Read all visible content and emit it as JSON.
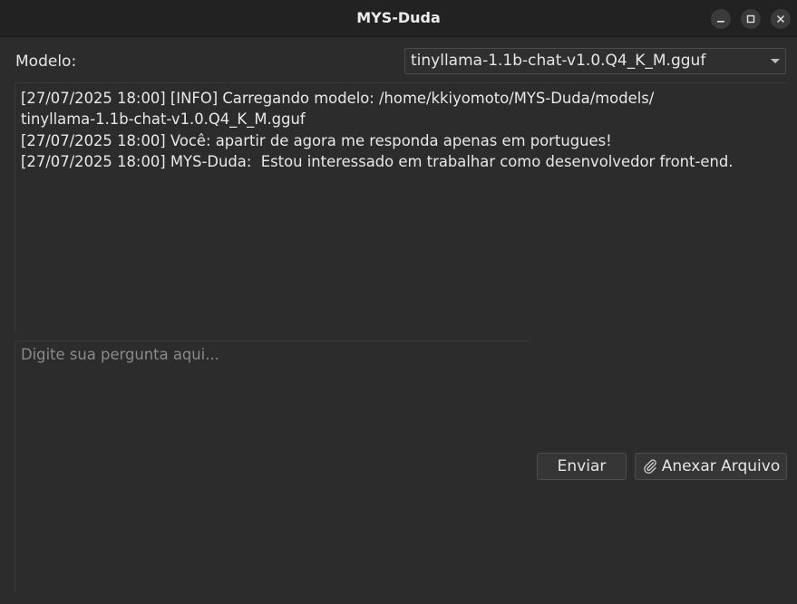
{
  "window": {
    "title": "MYS-Duda",
    "controls": [
      "minimize-icon",
      "maximize-icon",
      "close-icon"
    ]
  },
  "model": {
    "label": "Modelo:",
    "selected": "tinyllama-1.1b-chat-v1.0.Q4_K_M.gguf"
  },
  "chat": {
    "lines": [
      "[27/07/2025 18:00] [INFO] Carregando modelo: /home/kkiyomoto/MYS-Duda/models/",
      "tinyllama-1.1b-chat-v1.0.Q4_K_M.gguf",
      "[27/07/2025 18:00] Você: apartir de agora me responda apenas em portugues!",
      "[27/07/2025 18:00] MYS-Duda:  Estou interessado em trabalhar como desenvolvedor front-end."
    ]
  },
  "input": {
    "value": "",
    "placeholder": "Digite sua pergunta aqui..."
  },
  "buttons": {
    "send_label": "Enviar",
    "attach_label": "Anexar Arquivo",
    "attach_icon": "paperclip-icon"
  },
  "colors": {
    "background": "#2c2c2c",
    "titlebar": "#222222",
    "text": "#e8e8e8",
    "placeholder": "#8a8a8a"
  }
}
